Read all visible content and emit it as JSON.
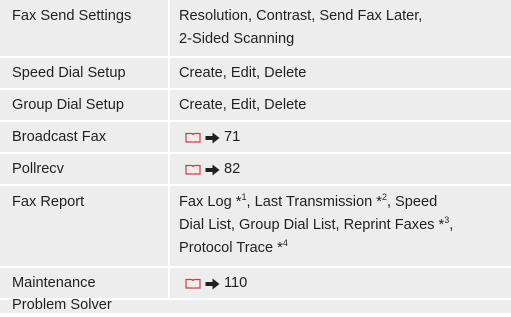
{
  "rows": [
    {
      "label": "Fax Send Settings",
      "value_lines": [
        "Resolution, Contrast, Send Fax Later,",
        "2-Sided Scanning"
      ]
    },
    {
      "label": "Speed Dial Setup",
      "value": "Create, Edit, Delete"
    },
    {
      "label": "Group Dial Setup",
      "value": "Create, Edit, Delete"
    },
    {
      "label": "Broadcast Fax",
      "page_ref": "71"
    },
    {
      "label": "Pollrecv",
      "page_ref": "82"
    },
    {
      "label": "Fax Report",
      "value_parts": {
        "p1": "Fax Log *",
        "s1": "1",
        "p2": ", Last Transmission *",
        "s2": "2",
        "p3": ", Speed",
        "line2": "Dial List, Group Dial List, Reprint Faxes *",
        "s3": "3",
        "p4": ",",
        "line3": "Protocol Trace *",
        "s4": "4"
      }
    },
    {
      "label": "Maintenance",
      "page_ref": "110"
    },
    {
      "label": "Problem Solver"
    }
  ],
  "icons": {
    "reference_book": "book-icon",
    "arrow": "right-arrow-icon",
    "book_color": "#e0373f",
    "arrow_color": "#231f20"
  },
  "colors": {
    "row_background": "#ededee",
    "text": "#231f20"
  }
}
